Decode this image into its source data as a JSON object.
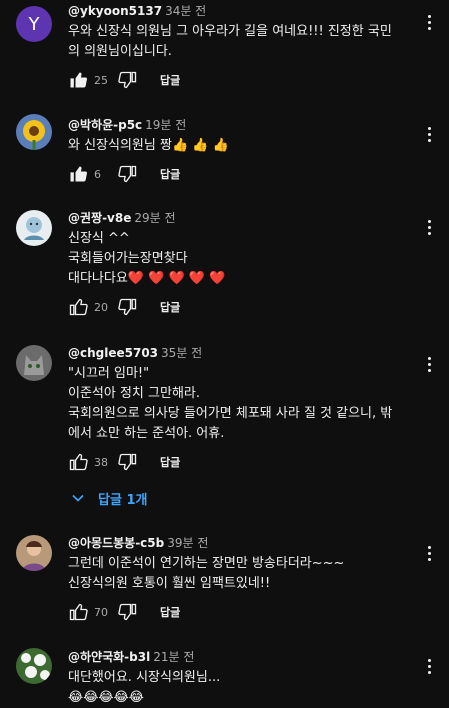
{
  "comments": [
    {
      "author": "@ykyoon5137",
      "time": "34분 전",
      "avatar_letter": "Y",
      "lines": [
        "우와 신장식 의원님 그 아우라가 길을 여네요!!! 진정한 국민",
        "의 의원님이십니다."
      ],
      "likes": "25",
      "reply_label": "답글"
    },
    {
      "author": "@박하윤-p5c",
      "time": "19분 전",
      "avatar_icon": "sunflower-avatar",
      "lines": [
        "와 신장식의원님 짱👍 👍 👍"
      ],
      "likes": "6",
      "reply_label": "답글"
    },
    {
      "author": "@권짱-v8e",
      "time": "29분 전",
      "avatar_icon": "drawing-avatar",
      "lines": [
        "신장식 ^^",
        "국회들어가는장면찾다",
        "대다나다요❤️ ❤️ ❤️ ❤️ ❤️"
      ],
      "likes": "20",
      "reply_label": "답글"
    },
    {
      "author": "@chglee5703",
      "time": "35분 전",
      "avatar_icon": "cat-avatar",
      "lines": [
        "\"시끄러 임마!\"",
        "이준석아 정치 그만해라.",
        "국회의원으로 의사당 들어가면 체포돼 사라 질 것 같으니, 밖",
        "에서 쇼만 하는 준석아. 어휴."
      ],
      "likes": "38",
      "reply_label": "답글",
      "replies_label": "답글 1개"
    },
    {
      "author": "@아몽드봉봉-c5b",
      "time": "39분 전",
      "avatar_icon": "person-avatar",
      "lines": [
        "그런데 이준석이 연기하는 장면만 방송타더라~~~",
        "신장식의원 호통이 훨씬 임팩트있네!!"
      ],
      "likes": "70",
      "reply_label": "답글"
    },
    {
      "author": "@하얀국화-b3l",
      "time": "21분 전",
      "avatar_icon": "flower-avatar",
      "lines": [
        "대단했어요.  시장식의원님...",
        "😂😂😂😂😂"
      ],
      "likes": "",
      "reply_label": ""
    }
  ],
  "icons": {
    "like": "thumbs-up-icon",
    "dislike": "thumbs-down-icon",
    "menu": "more-vert-icon",
    "expand": "chevron-down-icon"
  },
  "colors": {
    "background": "#0f0f0f",
    "text": "#f1f1f1",
    "secondary": "#aaaaaa",
    "link": "#3ea6ff",
    "avatar_y": "#5e35b1"
  }
}
